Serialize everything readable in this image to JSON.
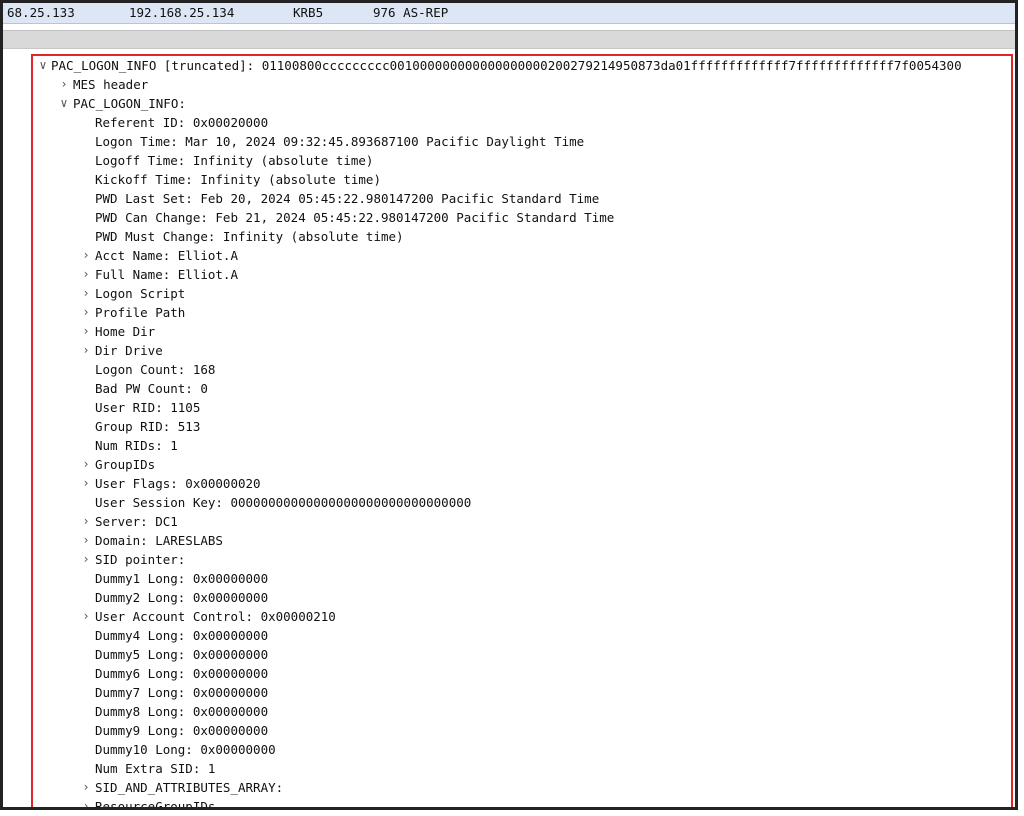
{
  "packet": {
    "src": "68.25.133",
    "dst": "192.168.25.134",
    "protocol": "KRB5",
    "info": "976 AS-REP"
  },
  "tree": [
    {
      "level": 0,
      "toggle": "expanded",
      "text": "PAC_LOGON_INFO [truncated]: 01100800ccccccccc001000000000000000000200279214950873da01fffffffffffff7fffffffffffff7f0054300"
    },
    {
      "level": 1,
      "toggle": "collapsed",
      "text": "MES header"
    },
    {
      "level": 1,
      "toggle": "expanded",
      "text": "PAC_LOGON_INFO:"
    },
    {
      "level": 2,
      "toggle": "none",
      "text": "Referent ID: 0x00020000"
    },
    {
      "level": 2,
      "toggle": "none",
      "text": "Logon Time: Mar 10, 2024 09:32:45.893687100 Pacific Daylight Time"
    },
    {
      "level": 2,
      "toggle": "none",
      "text": "Logoff Time: Infinity (absolute time)"
    },
    {
      "level": 2,
      "toggle": "none",
      "text": "Kickoff Time: Infinity (absolute time)"
    },
    {
      "level": 2,
      "toggle": "none",
      "text": "PWD Last Set: Feb 20, 2024 05:45:22.980147200 Pacific Standard Time"
    },
    {
      "level": 2,
      "toggle": "none",
      "text": "PWD Can Change: Feb 21, 2024 05:45:22.980147200 Pacific Standard Time"
    },
    {
      "level": 2,
      "toggle": "none",
      "text": "PWD Must Change: Infinity (absolute time)"
    },
    {
      "level": 2,
      "toggle": "collapsed",
      "text": "Acct Name: Elliot.A"
    },
    {
      "level": 2,
      "toggle": "collapsed",
      "text": "Full Name: Elliot.A"
    },
    {
      "level": 2,
      "toggle": "collapsed",
      "text": "Logon Script"
    },
    {
      "level": 2,
      "toggle": "collapsed",
      "text": "Profile Path"
    },
    {
      "level": 2,
      "toggle": "collapsed",
      "text": "Home Dir"
    },
    {
      "level": 2,
      "toggle": "collapsed",
      "text": "Dir Drive"
    },
    {
      "level": 2,
      "toggle": "none",
      "text": "Logon Count: 168"
    },
    {
      "level": 2,
      "toggle": "none",
      "text": "Bad PW Count: 0"
    },
    {
      "level": 2,
      "toggle": "none",
      "text": "User RID: 1105"
    },
    {
      "level": 2,
      "toggle": "none",
      "text": "Group RID: 513"
    },
    {
      "level": 2,
      "toggle": "none",
      "text": "Num RIDs: 1"
    },
    {
      "level": 2,
      "toggle": "collapsed",
      "text": "GroupIDs"
    },
    {
      "level": 2,
      "toggle": "collapsed",
      "text": "User Flags: 0x00000020"
    },
    {
      "level": 2,
      "toggle": "none",
      "text": "User Session Key: 00000000000000000000000000000000"
    },
    {
      "level": 2,
      "toggle": "collapsed",
      "text": "Server: DC1"
    },
    {
      "level": 2,
      "toggle": "collapsed",
      "text": "Domain: LARESLABS"
    },
    {
      "level": 2,
      "toggle": "collapsed",
      "text": "SID pointer:"
    },
    {
      "level": 2,
      "toggle": "none",
      "text": "Dummy1 Long: 0x00000000"
    },
    {
      "level": 2,
      "toggle": "none",
      "text": "Dummy2 Long: 0x00000000"
    },
    {
      "level": 2,
      "toggle": "collapsed",
      "text": "User Account Control: 0x00000210"
    },
    {
      "level": 2,
      "toggle": "none",
      "text": "Dummy4 Long: 0x00000000"
    },
    {
      "level": 2,
      "toggle": "none",
      "text": "Dummy5 Long: 0x00000000"
    },
    {
      "level": 2,
      "toggle": "none",
      "text": "Dummy6 Long: 0x00000000"
    },
    {
      "level": 2,
      "toggle": "none",
      "text": "Dummy7 Long: 0x00000000"
    },
    {
      "level": 2,
      "toggle": "none",
      "text": "Dummy8 Long: 0x00000000"
    },
    {
      "level": 2,
      "toggle": "none",
      "text": "Dummy9 Long: 0x00000000"
    },
    {
      "level": 2,
      "toggle": "none",
      "text": "Dummy10 Long: 0x00000000"
    },
    {
      "level": 2,
      "toggle": "none",
      "text": "Num Extra SID: 1"
    },
    {
      "level": 2,
      "toggle": "collapsed",
      "text": "SID_AND_ATTRIBUTES_ARRAY:"
    },
    {
      "level": 2,
      "toggle": "collapsed",
      "text": "ResourceGroupIDs"
    }
  ],
  "icons": {
    "expanded": "chevron-down-icon",
    "collapsed": "chevron-right-icon"
  }
}
